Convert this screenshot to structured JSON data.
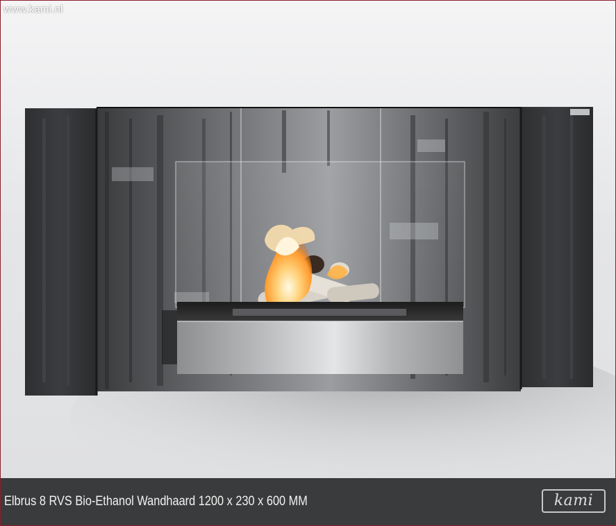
{
  "watermark": "www.kami.nl",
  "caption": "Elbrus 8 RVS Bio-Ethanol Wandhaard 1200 x 230 x 600 MM",
  "brand_logo": "kami",
  "colors": {
    "frame_border": "#8a1f2a",
    "caption_bg": "#3a3b3c",
    "caption_text": "#f2f2f2",
    "steel": "#b9bbbd",
    "flame": "#ffb347"
  }
}
